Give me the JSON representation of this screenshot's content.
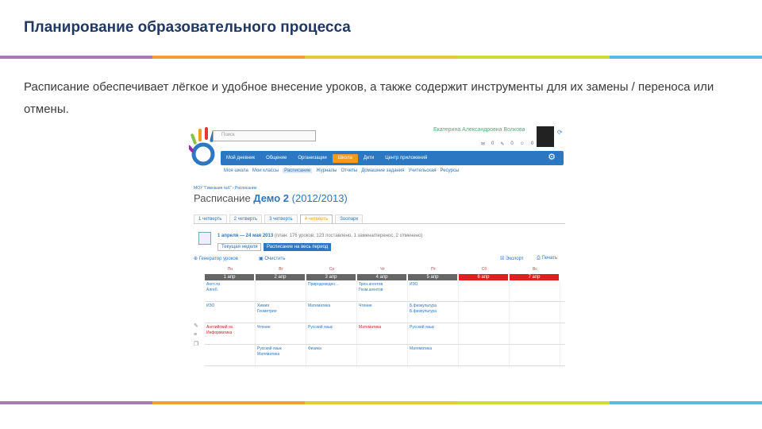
{
  "slide": {
    "title": "Планирование образовательного процесса",
    "description": "Расписание обеспечивает лёгкое и удобное внесение уроков, а также содержит инструменты для их замены / переноса или отмены.",
    "stripe_colors": [
      "#a97bb5",
      "#f29c3a",
      "#e6c93a",
      "#cddc39",
      "#5bb9e6"
    ]
  },
  "screenshot": {
    "search_placeholder": "Поиск",
    "username": "Екатерина Александровна Волкова",
    "header_counts": [
      "0",
      "0",
      "0"
    ],
    "nav": [
      "Мой дневник",
      "Общение",
      "Организации",
      "Школа",
      "Дети",
      "Центр приложений"
    ],
    "nav_active": "Школа",
    "subnav": [
      "Моя школа",
      "Мои классы",
      "Расписание",
      "Журналы",
      "Отчеты",
      "Домашние задания",
      "Учительская",
      "Ресурсы"
    ],
    "subnav_active": "Расписание",
    "breadcrumbs": "МОУ \"Гимназия №6\"  ›  Расписание",
    "page_title_prefix": "Расписание",
    "page_title_name": "Демо 2",
    "page_title_year": "(2012/2013)",
    "tabs": [
      "1 четверть",
      "2 четверть",
      "3 четверть",
      "4 четверть",
      "Зоопарк"
    ],
    "active_tab": "4 четверть",
    "week_range": "1 апреля — 24 мая 2013",
    "week_stats": "(план: 176 уроков, 123 поставлено, 1 замена/перенос, 2 отменено)",
    "btn_current_week": "Текущая неделя",
    "btn_whole_period": "Расписание на весь период",
    "generator": "Генератор уроков",
    "clear": "Очистить",
    "export": "Экспорт",
    "print": "Печать",
    "days": [
      "Пн",
      "Вт",
      "Ср",
      "Чт",
      "Пт",
      "Сб",
      "Вс"
    ],
    "dates": [
      "1 апр",
      "2 апр",
      "3 апр",
      "4 апр",
      "5 апр",
      "6 апр",
      "7 апр"
    ],
    "rows": [
      [
        "Англ.яз\nАлгеб.",
        "",
        "Природоведен...",
        "Трен.агентов\nГеом.агентов",
        "ИЗО",
        "",
        ""
      ],
      [
        "ИЗО",
        "Химия\nГеометрия",
        "Математика",
        "Чтение",
        "Б.физкультура\nБ.физкультура",
        "",
        ""
      ],
      [
        "Английский яз.\nИнформатика",
        "Чтение",
        "Русский язык",
        "Математика",
        "Русский язык",
        "",
        ""
      ],
      [
        "",
        "Русский язык\nМатематика",
        "Физика",
        "",
        "Математика",
        "",
        ""
      ]
    ],
    "red_cells": [
      [
        2,
        0,
        1
      ],
      [
        2,
        3,
        0
      ]
    ]
  }
}
